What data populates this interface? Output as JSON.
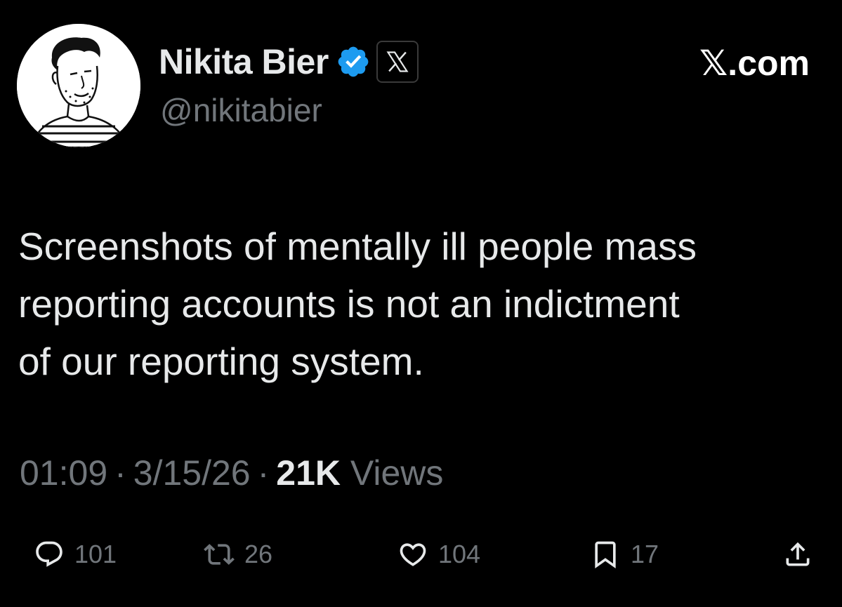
{
  "author": {
    "display_name": "Nikita Bier",
    "handle": "@nikitabier",
    "verified_badge_color": "#1d9bf0",
    "avatar_icon": "illustrated-portrait"
  },
  "brand": {
    "text": "𝕏.com"
  },
  "tweet": {
    "text": "Screenshots of mentally ill people mass\nreporting accounts is not an indictment\nof our reporting system."
  },
  "meta": {
    "time": "01:09",
    "separator": "·",
    "date": "3/15/26",
    "views_count": "21K",
    "views_label": "Views"
  },
  "actions": {
    "reply": {
      "icon": "reply-icon",
      "count": "101"
    },
    "retweet": {
      "icon": "retweet-icon",
      "count": "26"
    },
    "like": {
      "icon": "heart-icon",
      "count": "104"
    },
    "bookmark": {
      "icon": "bookmark-icon",
      "count": "17"
    },
    "share": {
      "icon": "share-icon"
    }
  },
  "colors": {
    "background": "#000000",
    "primary_text": "#e7e9ea",
    "secondary_text": "#71767b",
    "verified_blue": "#1d9bf0"
  }
}
